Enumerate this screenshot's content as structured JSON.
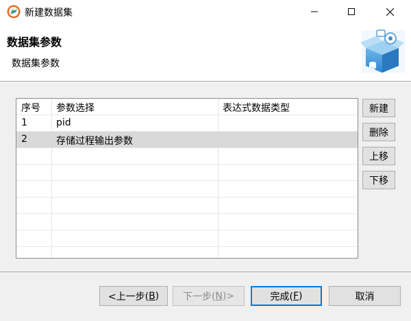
{
  "window": {
    "title": "新建数据集",
    "icons": {
      "app": "app-logo-icon",
      "minimize": "minimize-icon",
      "maximize": "maximize-icon",
      "close": "close-icon"
    }
  },
  "header": {
    "title": "数据集参数",
    "subtitle": "数据集参数",
    "banner_icon": "dataset-box-icon"
  },
  "table": {
    "columns": [
      "序号",
      "参数选择",
      "表达式数据类型"
    ],
    "rows": [
      {
        "index": "1",
        "param": "pid",
        "type": ""
      },
      {
        "index": "2",
        "param": "存储过程输出参数",
        "type": "",
        "selected": true
      }
    ]
  },
  "side_buttons": {
    "new": "新建",
    "delete": "删除",
    "move_up": "上移",
    "move_down": "下移"
  },
  "footer": {
    "prev": {
      "prefix": "<上一步(",
      "mnemonic": "B",
      "suffix": ")"
    },
    "next": {
      "prefix": "下一步(",
      "mnemonic": "N",
      "suffix": ")>",
      "disabled": true
    },
    "finish": {
      "prefix": "完成(",
      "mnemonic": "F",
      "suffix": ")"
    },
    "cancel": "取消"
  },
  "colors": {
    "selected_row": "#d9d9d9",
    "default_button_border": "#0078d7",
    "disabled_text": "#8a8a8a"
  }
}
